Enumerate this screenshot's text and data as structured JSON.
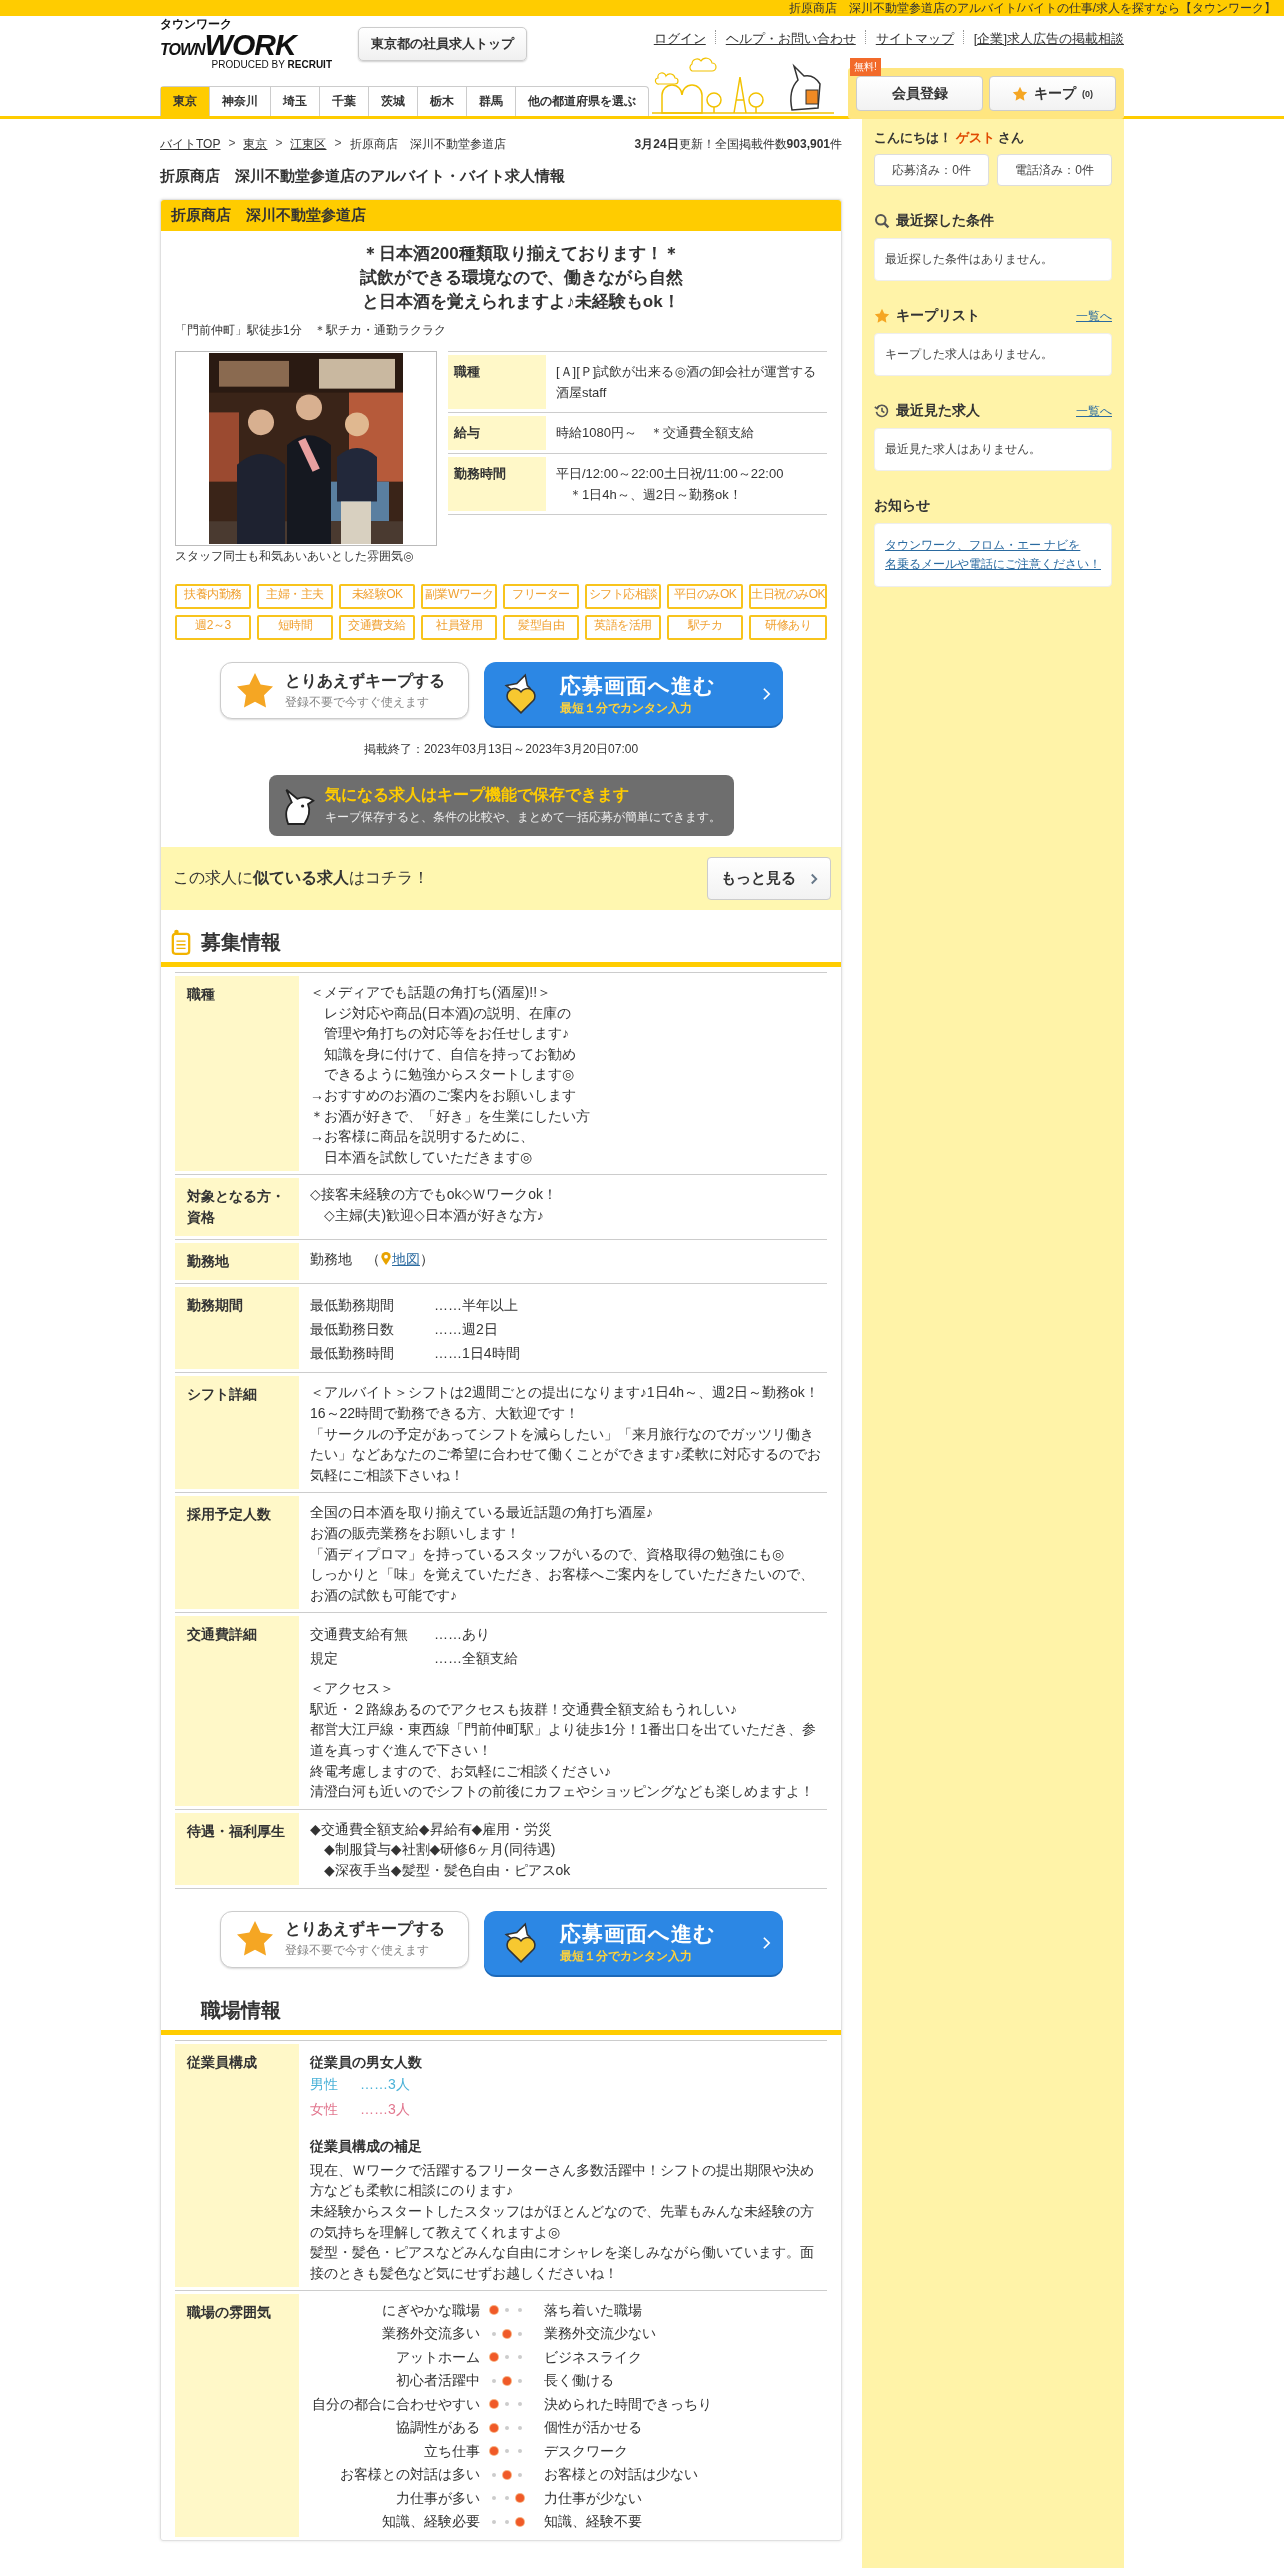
{
  "top_bar": {
    "text": "折原商店　深川不動堂参道店のアルバイト/バイトの仕事/求人を探すなら【タウンワーク】"
  },
  "header": {
    "logo": {
      "kana": "タウンワーク",
      "town": "TOWN",
      "work": "WORK",
      "produced_by": "PRODUCED BY",
      "company": "RECRUIT"
    },
    "top_button": "東京都の社員求人トップ",
    "links": [
      "ログイン",
      "ヘルプ・お問い合わせ",
      "サイトマップ",
      "[企業]求人広告の掲載相談"
    ],
    "tabs": [
      {
        "label": "東京",
        "selected": true
      },
      {
        "label": "神奈川",
        "selected": false
      },
      {
        "label": "埼玉",
        "selected": false
      },
      {
        "label": "千葉",
        "selected": false
      },
      {
        "label": "茨城",
        "selected": false
      },
      {
        "label": "栃木",
        "selected": false
      },
      {
        "label": "群馬",
        "selected": false
      },
      {
        "label": "他の都道府県を選ぶ",
        "selected": false
      }
    ],
    "free_badge": "無料!",
    "register_button": "会員登録",
    "keep_button": {
      "label": "キープ",
      "count": "(0)"
    }
  },
  "breadcrumb": {
    "separator": ">",
    "items": [
      "バイトTOP",
      "東京",
      "江東区",
      "折原商店　深川不動堂参道店"
    ]
  },
  "update_info": "**3月24日**更新！全国掲載件数**903,901**件",
  "page_title": "折原商店　深川不動堂参道店のアルバイト・バイト求人情報",
  "job": {
    "shop": "折原商店　深川不動堂参道店",
    "catch_copy": [
      "＊日本酒200種類取り揃えております！＊",
      "試飲ができる環境なので、働きながら自然",
      "と日本酒を覚えられますよ♪未経験もok！"
    ],
    "access": "「門前仲町」駅徒歩1分　＊駅チカ・通勤ラクラク",
    "photo": {
      "kind": "picture",
      "caption": "スタッフ同士も和気あいあいとした雰囲気◎"
    },
    "summary": [
      {
        "label": "職種",
        "lines": [
          "[Ａ][Ｐ]試飲が出来る◎酒の卸会社が運営する酒屋staff"
        ]
      },
      {
        "label": "給与",
        "lines": [
          "時給1080円～　＊交通費全額支給"
        ]
      },
      {
        "label": "勤務時間",
        "lines": [
          "平日/12:00～22:00土日祝/11:00～22:00",
          "　＊1日4h～、週2日～勤務ok！"
        ]
      }
    ],
    "tags": [
      "扶養内勤務",
      "主婦・主夫",
      "未経験OK",
      "副業Wワーク",
      "フリーター",
      "シフト応相談",
      "平日のみOK",
      "土日祝のみOK",
      "週2～3",
      "短時間",
      "交通費支給",
      "社員登用",
      "髪型自由",
      "英語を活用",
      "駅チカ",
      "研修あり"
    ],
    "actions": {
      "keep_title": "とりあえずキープする",
      "keep_sub": "登録不要で今すぐ使えます",
      "apply_title": "応募画面へ進む",
      "apply_sub": "最短１分でカンタン入力"
    },
    "period": "掲載終了：2023年03月13日～2023年3月20日07:00",
    "keep_banner": {
      "title": "気になる求人はキープ機能で保存できます",
      "text": "キープ保存すると、条件の比較や、まとめて一括応募が簡単にできます。"
    },
    "similar": {
      "text": "この求人に**似ている求人**はコチラ！",
      "button": "もっと見る"
    }
  },
  "recruit_info": {
    "title": "募集情報",
    "rows": [
      {
        "kind": "text",
        "label": "職種",
        "lines": [
          "＜メディアでも話題の角打ち(酒屋)!!＞",
          "　レジ対応や商品(日本酒)の説明、在庫の",
          "　管理や角打ちの対応等をお任せします♪",
          "　知識を身に付けて、自信を持ってお勧め",
          "　できるように勉強からスタートします◎",
          "→おすすめのお酒のご案内をお願いします",
          "＊お酒が好きで、「好き」を生業にしたい方",
          "→お客様に商品を説明するために、",
          "　日本酒を試飲していただきます◎"
        ]
      },
      {
        "kind": "text",
        "label": "対象となる方・資格",
        "lines": [
          "◇接客未経験の方でもok◇Ｗワークok！",
          "　◇主婦(夫)歓迎◇日本酒が好きな方♪"
        ]
      },
      {
        "kind": "map",
        "label": "勤務地",
        "prefix": "勤務地　（",
        "link": "地図",
        "suffix": "）"
      },
      {
        "kind": "pairs",
        "label": "勤務期間",
        "pairs": [
          {
            "name": "最低勤務期間",
            "value": "……半年以上"
          },
          {
            "name": "最低勤務日数",
            "value": "……週2日"
          },
          {
            "name": "最低勤務時間",
            "value": "……1日4時間"
          }
        ]
      },
      {
        "kind": "text",
        "label": "シフト詳細",
        "lines": [
          "＜アルバイト＞シフトは2週間ごとの提出になります♪1日4h～、週2日～勤務ok！",
          "16～22時間で勤務できる方、大歓迎です！",
          "「サークルの予定があってシフトを減らしたい」「来月旅行なのでガッツリ働きたい」などあなたのご希望に合わせて働くことができます♪柔軟に対応するのでお気軽にご相談下さいね！"
        ]
      },
      {
        "kind": "text",
        "label": "採用予定人数",
        "lines": [
          "全国の日本酒を取り揃えている最近話題の角打ち酒屋♪",
          "お酒の販売業務をお願いします！",
          "「酒ディプロマ」を持っているスタッフがいるので、資格取得の勉強にも◎",
          "しっかりと「味」を覚えていただき、お客様へご案内をしていただきたいので、",
          "お酒の試飲も可能です♪"
        ]
      },
      {
        "kind": "pairs",
        "label": "交通費詳細",
        "pairs": [
          {
            "name": "交通費支給有無",
            "value": "……あり"
          },
          {
            "name": "規定",
            "value": "……全額支給"
          }
        ],
        "lines": [
          "＜アクセス＞",
          "駅近・２路線あるのでアクセスも抜群！交通費全額支給もうれしい♪",
          "都営大江戸線・東西線「門前仲町駅」より徒歩1分！1番出口を出ていただき、参道を真っすぐ進んで下さい！",
          "終電考慮しますので、お気軽にご相談ください♪",
          "清澄白河も近いのでシフトの前後にカフェやショッピングなども楽しめますよ！"
        ]
      },
      {
        "kind": "text",
        "label": "待遇・福利厚生",
        "lines": [
          "◆交通費全額支給◆昇給有◆雇用・労災",
          "　◆制服貸与◆社割◆研修6ヶ月(同待遇)",
          "　◆深夜手当◆髪型・髪色自由・ピアスok"
        ]
      }
    ]
  },
  "actions_bottom": {
    "keep_title": "とりあえずキープする",
    "keep_sub": "登録不要で今すぐ使えます",
    "apply_title": "応募画面へ進む",
    "apply_sub": "最短１分でカンタン入力"
  },
  "workplace": {
    "title": "職場情報",
    "staff": {
      "label": "従業員構成",
      "gender_title": "従業員の男女人数",
      "genders": [
        {
          "label": "男性",
          "value": "……3人",
          "color": "#4bb2d8"
        },
        {
          "label": "女性",
          "value": "……3人",
          "color": "#e2778f"
        }
      ],
      "note_title": "従業員構成の補足",
      "note": [
        "現在、Ｗワークで活躍するフリーターさん多数活躍中！シフトの提出期限や決め方なども柔軟に相談にのります♪",
        "未経験からスタートしたスタッフはがほとんどなので、先輩もみんな未経験の方の気持ちを理解して教えてくれますよ◎",
        "髪型・髪色・ピアスなどみんな自由にオシャレを楽しみながら働いています。面接のときも髪色など気にせずお越しくださいね！"
      ]
    },
    "atmosphere": {
      "label": "職場の雰囲気",
      "rows": [
        {
          "left": "にぎやかな職場",
          "right": "落ち着いた職場",
          "dots": [
            {
              "on": true
            },
            {
              "on": false
            },
            {
              "on": false
            }
          ]
        },
        {
          "left": "業務外交流多い",
          "right": "業務外交流少ない",
          "dots": [
            {
              "on": false
            },
            {
              "on": true
            },
            {
              "on": false
            }
          ]
        },
        {
          "left": "アットホーム",
          "right": "ビジネスライク",
          "dots": [
            {
              "on": true
            },
            {
              "on": false
            },
            {
              "on": false
            }
          ]
        },
        {
          "left": "初心者活躍中",
          "right": "長く働ける",
          "dots": [
            {
              "on": false
            },
            {
              "on": true
            },
            {
              "on": false
            }
          ]
        },
        {
          "left": "自分の都合に合わせやすい",
          "right": "決められた時間できっちり",
          "dots": [
            {
              "on": true
            },
            {
              "on": false
            },
            {
              "on": false
            }
          ]
        },
        {
          "left": "協調性がある",
          "right": "個性が活かせる",
          "dots": [
            {
              "on": true
            },
            {
              "on": false
            },
            {
              "on": false
            }
          ]
        },
        {
          "left": "立ち仕事",
          "right": "デスクワーク",
          "dots": [
            {
              "on": true
            },
            {
              "on": false
            },
            {
              "on": false
            }
          ]
        },
        {
          "left": "お客様との対話は多い",
          "right": "お客様との対話は少ない",
          "dots": [
            {
              "on": false
            },
            {
              "on": true
            },
            {
              "on": false
            }
          ]
        },
        {
          "left": "力仕事が多い",
          "right": "力仕事が少ない",
          "dots": [
            {
              "on": false
            },
            {
              "on": false
            },
            {
              "on": true
            }
          ]
        },
        {
          "left": "知識、経験必要",
          "right": "知識、経験不要",
          "dots": [
            {
              "on": false
            },
            {
              "on": false
            },
            {
              "on": true
            }
          ]
        }
      ]
    }
  },
  "sidebar": {
    "greeting": {
      "hello": "こんにちは！",
      "name": "ゲスト",
      "suffix": "さん"
    },
    "counters": [
      "応募済み：0件",
      "電話済み：0件"
    ],
    "sections": [
      {
        "kind": "search",
        "title": "最近探した条件",
        "empty": "最近探した条件はありません。"
      },
      {
        "kind": "keep",
        "title": "キープリスト",
        "link": "一覧へ",
        "empty": "キープした求人はありません。"
      },
      {
        "kind": "history",
        "title": "最近見た求人",
        "link": "一覧へ",
        "empty": "最近見た求人はありません。"
      },
      {
        "kind": "notice",
        "title": "お知らせ",
        "notice_lines": [
          "タウンワーク、フロム・エー ナビを",
          "名乗るメールや電話にご注意ください！"
        ]
      }
    ]
  }
}
